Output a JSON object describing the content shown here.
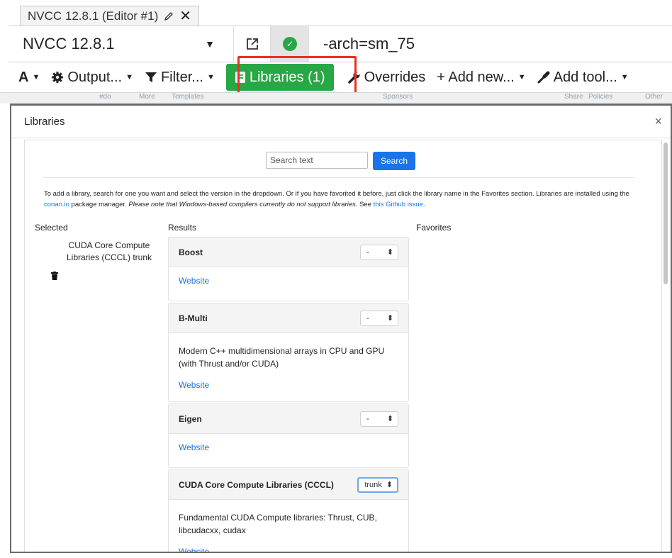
{
  "editor_tab": {
    "title": "NVCC 12.8.1 (Editor #1)"
  },
  "compiler": {
    "name": "NVCC 12.8.1",
    "options": "-arch=sm_75"
  },
  "toolbar": {
    "font_label": "A",
    "output_label": "Output...",
    "filter_label": "Filter...",
    "libraries_label": "Libraries (1)",
    "overrides_label": "Overrides",
    "add_new_label": "+ Add new...",
    "add_tool_label": "Add tool..."
  },
  "background_strip": {
    "items": [
      "#do",
      "More",
      "Templates",
      "Sponsors",
      "Share",
      "Policies",
      "Other"
    ]
  },
  "modal": {
    "title": "Libraries",
    "search": {
      "placeholder": "Search text",
      "button": "Search"
    },
    "help": {
      "part1": "To add a library, search for one you want and select the version in the dropdown. Or if you have favorited it before, just click the library name in the Favorites section. Libraries are installed using the ",
      "conan_link": "conan.io",
      "part2": " package manager. ",
      "note": "Please note that Windows-based compilers currently do not support libraries.",
      "part3": " See ",
      "issue_link": "this Github issue",
      "part4": "."
    },
    "columns": {
      "selected": "Selected",
      "results": "Results",
      "favorites": "Favorites"
    },
    "selected_library": "CUDA Core Compute Libraries (CCCL) trunk",
    "results": [
      {
        "name": "Boost",
        "version": "-",
        "description": "",
        "link": "Website"
      },
      {
        "name": "B-Multi",
        "version": "-",
        "description": "Modern C++ multidimensional arrays in CPU and GPU (with Thrust and/or CUDA)",
        "link": "Website"
      },
      {
        "name": "Eigen",
        "version": "-",
        "description": "",
        "link": "Website"
      },
      {
        "name": "CUDA Core Compute Libraries (CCCL)",
        "version": "trunk",
        "description": "Fundamental CUDA Compute libraries: Thrust, CUB, libcudacxx, cudax",
        "link": "Website"
      }
    ]
  },
  "colors": {
    "success": "#28a745",
    "link": "#1a73e8",
    "highlight": "#e8321f"
  }
}
